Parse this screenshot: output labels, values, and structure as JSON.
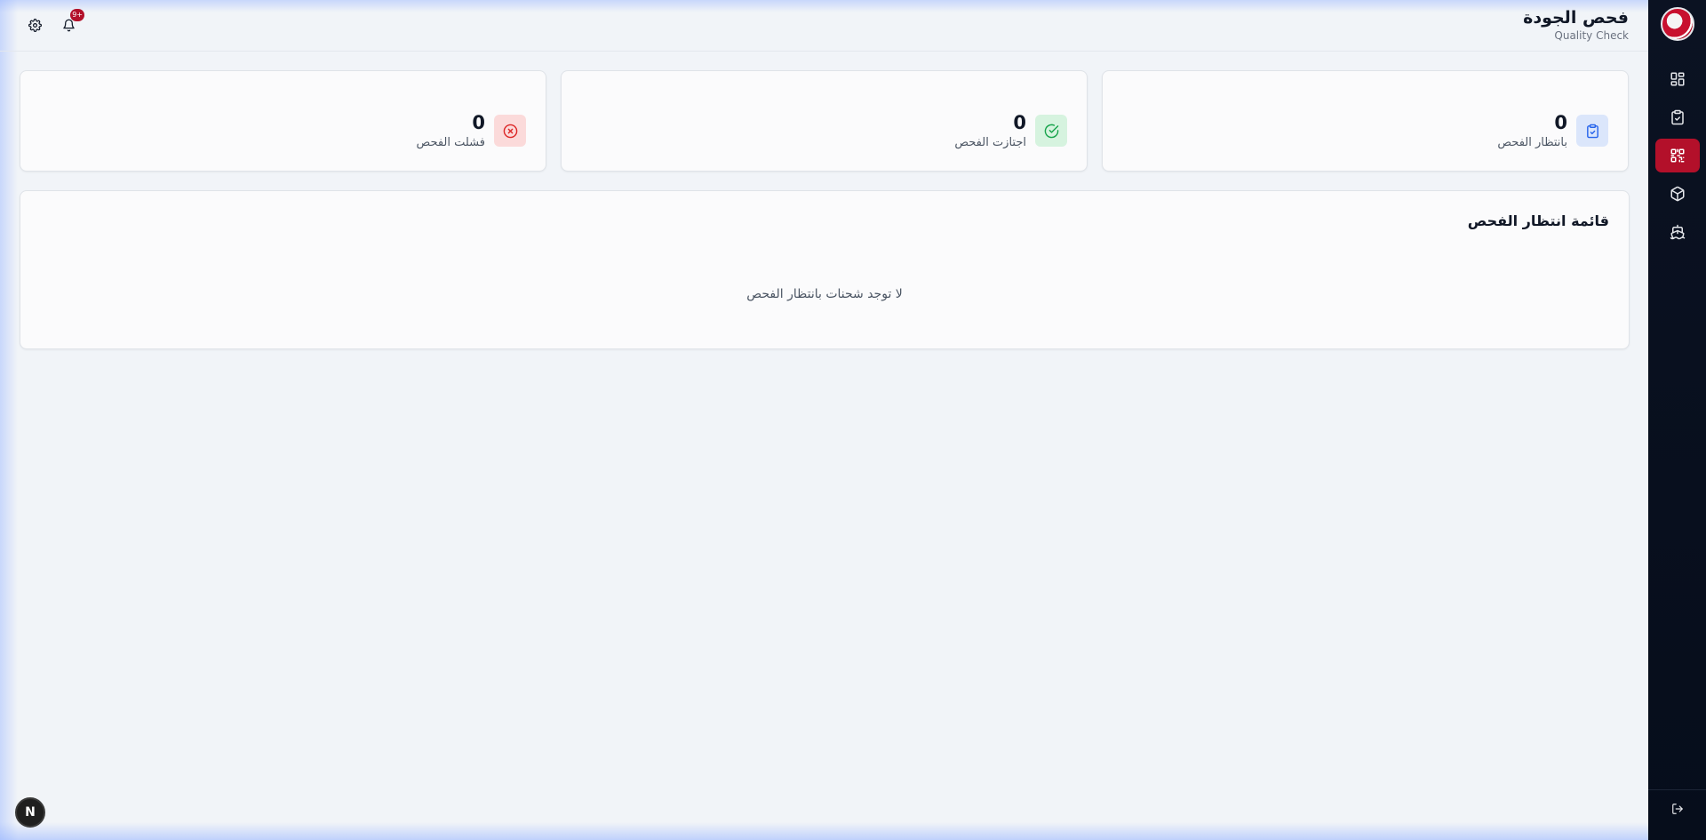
{
  "header": {
    "title": "فحص الجودة",
    "subtitle": "Quality Check",
    "notification_count": "9+"
  },
  "sidebar": {
    "items": [
      {
        "icon": "dashboard-icon",
        "active": false
      },
      {
        "icon": "clipboard-check-icon",
        "active": false
      },
      {
        "icon": "qr-code-icon",
        "active": true
      },
      {
        "icon": "package-icon",
        "active": false
      },
      {
        "icon": "ship-icon",
        "active": false
      }
    ],
    "logout_icon": "logout-icon"
  },
  "stats": [
    {
      "value": "0",
      "label": "بانتظار الفحص",
      "icon": "clipboard-check-icon",
      "color": "#2563eb",
      "bg": "#dbe6fb"
    },
    {
      "value": "0",
      "label": "اجتازت الفحص",
      "icon": "check-circle-icon",
      "color": "#16a34a",
      "bg": "#d6f3df"
    },
    {
      "value": "0",
      "label": "فشلت الفحص",
      "icon": "x-circle-icon",
      "color": "#dc2626",
      "bg": "#fbdada"
    }
  ],
  "queue": {
    "title": "قائمة انتظار الفحص",
    "empty_message": "لا توجد شحنات بانتظار الفحص"
  },
  "dev_bubble": "N"
}
